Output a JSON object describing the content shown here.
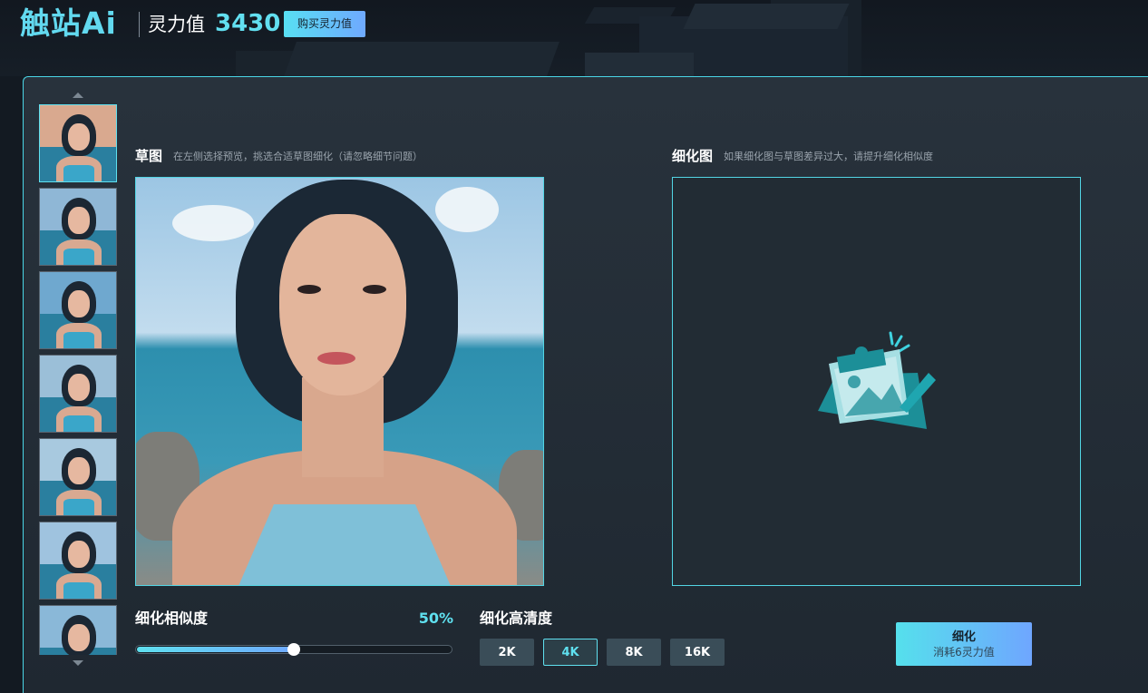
{
  "header": {
    "logo": "触站Ai",
    "power_label": "灵力值",
    "power_value": "3430",
    "buy_button": "购买灵力值"
  },
  "thumbnails": {
    "count_visible": 7,
    "selected_index": 0,
    "sky_colors": [
      "#d9a98f",
      "#8fb7d6",
      "#6fa8cf",
      "#9bbfd8",
      "#a8c9df",
      "#9fc3df",
      "#8ab8d8"
    ]
  },
  "sketch": {
    "title": "草图",
    "hint": "在左侧选择预览，挑选合适草图细化（请忽略细节问题）"
  },
  "refined": {
    "title": "细化图",
    "hint": "如果细化图与草图差异过大，请提升细化相似度"
  },
  "similarity": {
    "label": "细化相似度",
    "value_text": "50%",
    "value": 0.5
  },
  "resolution": {
    "label": "细化高清度",
    "options": [
      "2K",
      "4K",
      "8K",
      "16K"
    ],
    "selected": "4K"
  },
  "refine_button": {
    "label": "细化",
    "cost": "消耗6灵力值"
  },
  "colors": {
    "accent": "#5fe0ef",
    "gradient_end": "#6fa9ff",
    "panel": "#28323c"
  }
}
